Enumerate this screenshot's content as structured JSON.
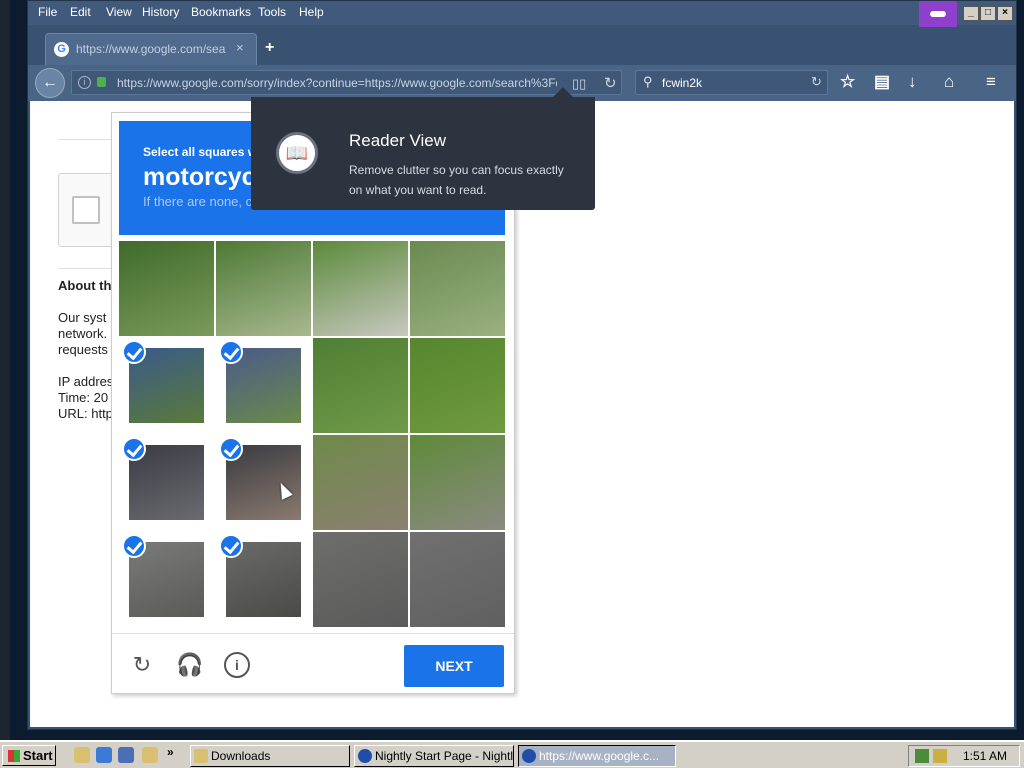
{
  "menubar": {
    "items": [
      "File",
      "Edit",
      "View",
      "History",
      "Bookmarks",
      "Tools",
      "Help"
    ]
  },
  "tab": {
    "title": "https://www.google.com/sea",
    "close": "×",
    "new_tab": "+"
  },
  "navbar": {
    "url": "https://www.google.com/sorry/index?continue=https://www.google.com/search%3Fq%3",
    "search_query": "fcwin2k"
  },
  "page": {
    "about_heading": "About th",
    "para1_line1": "Our syst",
    "para1_line2": "network.",
    "para1_line3": "requests",
    "ip_label": "IP addres",
    "time_label": "Time: 20",
    "url_label": "URL: http"
  },
  "captcha": {
    "instruction": "Select all squares with",
    "target": "motorcycles",
    "hint": "If there are none, click skip",
    "next_label": "NEXT",
    "tiles_selected": [
      [
        false,
        false,
        false,
        false
      ],
      [
        true,
        true,
        false,
        false
      ],
      [
        true,
        true,
        false,
        false
      ],
      [
        true,
        true,
        false,
        false
      ]
    ]
  },
  "reader_popup": {
    "title": "Reader View",
    "description": "Remove clutter so you can focus exactly on what you want to read."
  },
  "taskbar": {
    "start_label": "Start",
    "tasks": [
      {
        "label": "Downloads"
      },
      {
        "label": "Nightly Start Page - Nightly"
      },
      {
        "label": "https://www.google.c..."
      }
    ],
    "clock": "1:51 AM"
  }
}
